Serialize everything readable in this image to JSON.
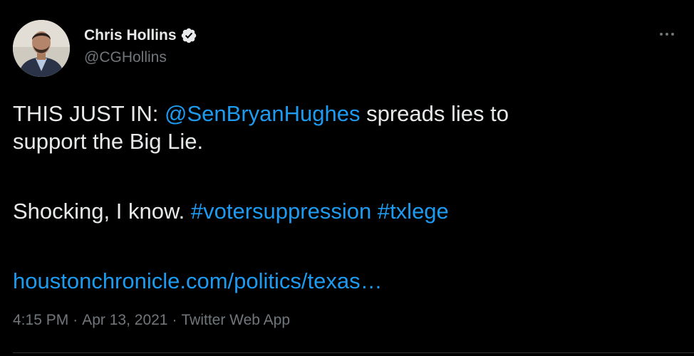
{
  "author": {
    "display_name": "Chris Hollins",
    "handle": "@CGHollins",
    "verified": true,
    "avatar_icon": "profile-photo"
  },
  "menu": {
    "more_icon": "more-horizontal-icon"
  },
  "tweet": {
    "line1_prefix": "THIS JUST IN: ",
    "mention": "@SenBryanHughes",
    "line1_suffix": " spreads lies to",
    "line2": "support the Big Lie.",
    "line3_prefix": "Shocking, I know. ",
    "hashtag1": "#votersuppression",
    "hashtag2": "#txlege",
    "url": "houstonchronicle.com/politics/texas…"
  },
  "meta": {
    "time": "4:15 PM",
    "separator": "·",
    "date": "Apr 13, 2021",
    "source": "Twitter Web App"
  },
  "colors": {
    "background": "#000000",
    "text": "#e7e9ea",
    "secondary": "#71767b",
    "accent": "#1d9bf0"
  }
}
